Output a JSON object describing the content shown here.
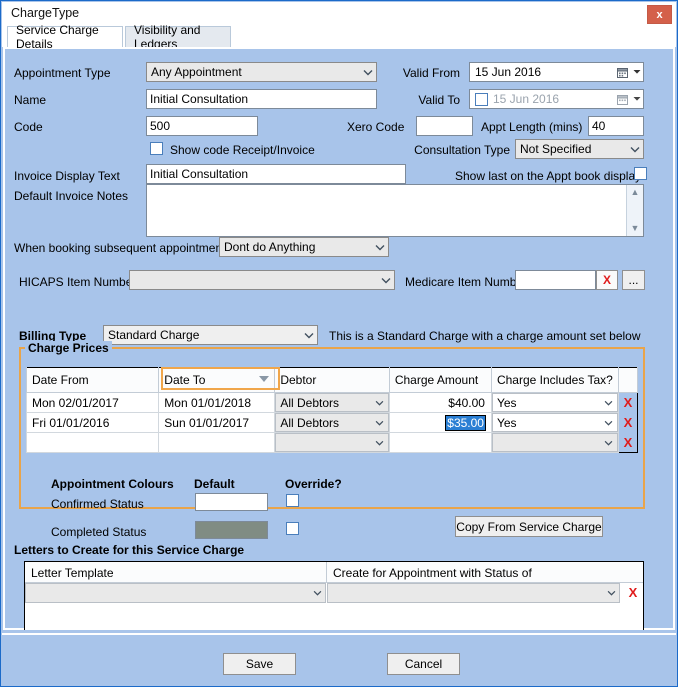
{
  "window": {
    "title": "ChargeType",
    "close_label": "x"
  },
  "tabs": [
    {
      "label": "Service Charge Details",
      "active": true
    },
    {
      "label": "Visibility and Ledgers",
      "active": false
    }
  ],
  "form": {
    "appointment_type_label": "Appointment Type",
    "appointment_type_value": "Any Appointment",
    "name_label": "Name",
    "name_value": "Initial Consultation",
    "code_label": "Code",
    "code_value": "500",
    "xero_code_label": "Xero Code",
    "xero_code_value": "",
    "show_code_receipt_label": "Show code Receipt/Invoice",
    "show_code_receipt_checked": false,
    "invoice_display_text_label": "Invoice Display Text",
    "invoice_display_text_value": "Initial Consultation",
    "default_invoice_notes_label": "Default Invoice Notes",
    "default_invoice_notes_value": "",
    "subsequent_label": "When booking subsequent appointments",
    "subsequent_value": "Dont do Anything",
    "hicaps_label": "HICAPS Item Number",
    "hicaps_value": "",
    "medicare_label": "Medicare Item Number",
    "medicare_value": "",
    "medicare_clear_label": "X",
    "medicare_browse_label": "...",
    "valid_from_label": "Valid From",
    "valid_from_value": "15 Jun 2016",
    "valid_to_label": "Valid To",
    "valid_to_value": "15 Jun 2016",
    "valid_to_enabled": false,
    "appt_length_label": "Appt Length (mins)",
    "appt_length_value": "40",
    "consultation_type_label": "Consultation Type",
    "consultation_type_value": "Not Specified",
    "show_last_label": "Show last on the Appt book display",
    "show_last_checked": false
  },
  "billing": {
    "label": "Billing Type",
    "value": "Standard Charge",
    "hint": "This is a Standard Charge with a charge amount set below"
  },
  "charge_prices": {
    "group_title": "Charge Prices",
    "columns": [
      "Date From",
      "Date To",
      "Debtor",
      "Charge Amount",
      "Charge Includes Tax?"
    ],
    "sorted_column": "Date To",
    "rows": [
      {
        "date_from": "Mon 02/01/2017",
        "date_to": "Mon 01/01/2018",
        "debtor": "All Debtors",
        "amount": "$40.00",
        "includes_tax": "Yes",
        "selected": false,
        "delete_label": "X"
      },
      {
        "date_from": "Fri 01/01/2016",
        "date_to": "Sun 01/01/2017",
        "debtor": "All Debtors",
        "amount": "$35.00",
        "includes_tax": "Yes",
        "selected": true,
        "delete_label": "X"
      },
      {
        "date_from": "",
        "date_to": "",
        "debtor": "",
        "amount": "",
        "includes_tax": "",
        "selected": false,
        "delete_label": "X"
      }
    ]
  },
  "appointment_colours": {
    "title": "Appointment Colours",
    "default_header": "Default",
    "override_header": "Override?",
    "rows": [
      {
        "label": "Confirmed Status",
        "colour": "#ffffff",
        "override": false
      },
      {
        "label": "Completed Status",
        "colour": "#808c83",
        "override": false
      }
    ],
    "copy_button": "Copy From Service Charge"
  },
  "letters": {
    "title": "Letters to Create for this Service Charge",
    "columns": [
      "Letter Template",
      "Create for Appointment with Status of"
    ],
    "rows": [
      {
        "template": "",
        "status": "",
        "delete_label": "X"
      }
    ]
  },
  "footer": {
    "save_label": "Save",
    "cancel_label": "Cancel"
  },
  "colors": {
    "background": "#a8c4ea",
    "accent_orange": "#e9a44a",
    "select_blue": "#2a7fd4",
    "delete_red": "#e01b1b",
    "close_red": "#d4604a"
  }
}
